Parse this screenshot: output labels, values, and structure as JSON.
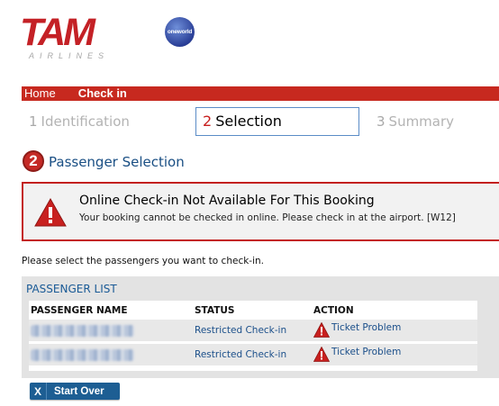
{
  "header": {
    "logo_word": "TAM",
    "logo_sub": "AIRLINES",
    "alliance_badge": "oneworld"
  },
  "nav": {
    "home": "Home",
    "checkin": "Check in"
  },
  "steps": [
    {
      "number": "1",
      "label": "Identification",
      "active": false
    },
    {
      "number": "2",
      "label": "Selection",
      "active": true
    },
    {
      "number": "3",
      "label": "Summary",
      "active": false
    }
  ],
  "section": {
    "number": "2",
    "title": "Passenger Selection"
  },
  "alert": {
    "icon": "warning-icon",
    "title": "Online Check-in Not Available For This Booking",
    "message": "Your booking cannot be checked in online. Please check in at the airport. [W12]"
  },
  "instruction": "Please select the passengers you want to check-in.",
  "passenger_list": {
    "title": "PASSENGER LIST",
    "columns": [
      "PASSENGER NAME",
      "STATUS",
      "ACTION"
    ],
    "rows": [
      {
        "status": "Restricted Check-in",
        "action_icon": "warning-icon",
        "action": "Ticket Problem"
      },
      {
        "status": "Restricted Check-in",
        "action_icon": "warning-icon",
        "action": "Ticket Problem"
      }
    ]
  },
  "start_over": {
    "icon": "close-icon",
    "x": "X",
    "label": "Start Over"
  },
  "colors": {
    "brand_red": "#c7291f",
    "link_blue": "#1b4f8a",
    "button_blue": "#1d5e93"
  }
}
